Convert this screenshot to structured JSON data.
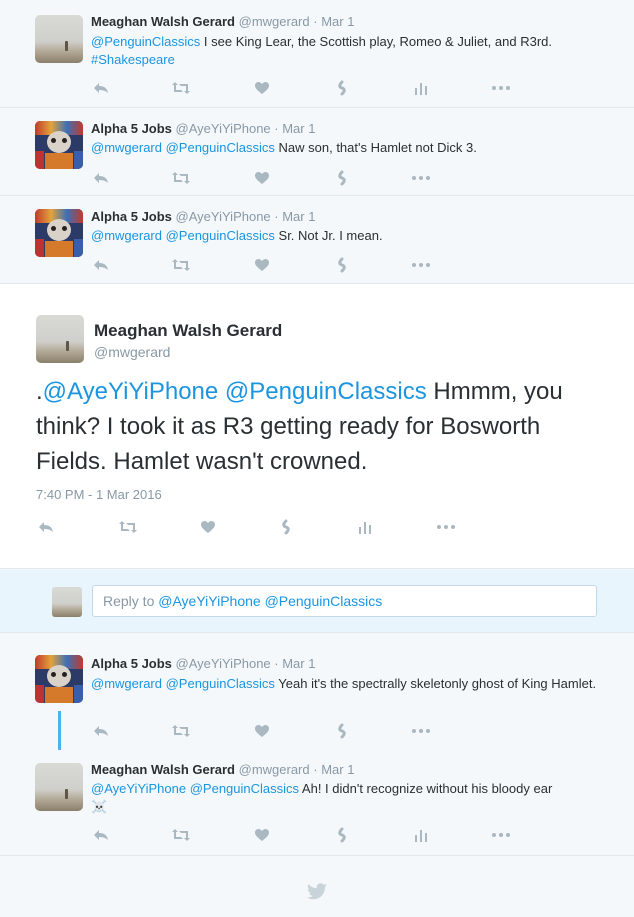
{
  "tweets": [
    {
      "name": "Meaghan Walsh Gerard",
      "handle": "@mwgerard",
      "time": "· Mar 1",
      "parts": [
        {
          "t": "@PenguinClassics",
          "link": true
        },
        {
          "t": " I see King Lear, the Scottish play, Romeo & Juliet, and R3rd. ",
          "link": false
        },
        {
          "t": "#Shakespeare",
          "link": true
        }
      ]
    },
    {
      "name": "Alpha 5 Jobs",
      "handle": "@AyeYiYiPhone",
      "time": "· Mar 1",
      "parts": [
        {
          "t": "@mwgerard @PenguinClassics",
          "link": true
        },
        {
          "t": " Naw son, that's Hamlet not Dick 3.",
          "link": false
        }
      ]
    },
    {
      "name": "Alpha 5 Jobs",
      "handle": "@AyeYiYiPhone",
      "time": "· Mar 1",
      "parts": [
        {
          "t": "@mwgerard @PenguinClassics",
          "link": true
        },
        {
          "t": " Sr. Not Jr. I mean.",
          "link": false
        }
      ]
    }
  ],
  "main_tweet": {
    "name": "Meaghan Walsh Gerard",
    "handle": "@mwgerard",
    "prefix": ".",
    "mentions": "@AyeYiYiPhone @PenguinClassics",
    "body": " Hmmm, you think? I took it as R3 getting ready for Bosworth Fields. Hamlet wasn't crowned.",
    "timestamp": "7:40 PM - 1 Mar 2016"
  },
  "reply_box": {
    "label": "Reply to ",
    "mentions": "@AyeYiYiPhone @PenguinClassics"
  },
  "replies": [
    {
      "name": "Alpha 5 Jobs",
      "handle": "@AyeYiYiPhone",
      "time": "· Mar 1",
      "mentions": "@mwgerard @PenguinClassics",
      "body": " Yeah it's the spectrally skeletonly ghost of King Hamlet."
    },
    {
      "name": "Meaghan Walsh Gerard",
      "handle": "@mwgerard",
      "time": "· Mar 1",
      "mentions": "@AyeYiYiPhone @PenguinClassics",
      "body": " Ah! I didn't recognize without his bloody ear",
      "emoji": "☠️"
    }
  ],
  "action_icons": [
    "reply-icon",
    "retweet-icon",
    "like-icon",
    "moment-icon",
    "analytics-icon",
    "more-icon"
  ],
  "colors": {
    "link": "#1b95e0",
    "muted": "#8899a6",
    "icon": "#aab8c2",
    "thread_line": "#4ab3f4",
    "reply_bg": "#e8f5fd"
  }
}
